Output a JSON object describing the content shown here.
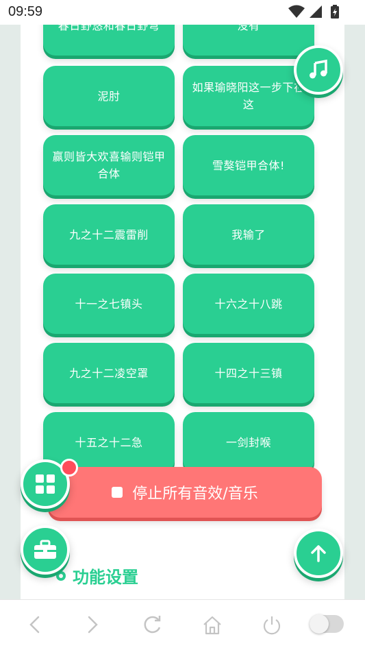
{
  "status_bar": {
    "time": "09:59"
  },
  "sound_buttons": [
    "春日野悠和春日野穹",
    "没有",
    "泥肘",
    "如果瑜晓阳这一步下在这",
    "赢则皆大欢喜输则铠甲合体",
    "雪獒铠甲合体!",
    "九之十二震雷削",
    "我输了",
    "十一之七镇头",
    "十六之十八跳",
    "九之十二凌空罩",
    "十四之十三镇",
    "十五之十二急",
    "一剑封喉"
  ],
  "stop_button": {
    "label": "停止所有音效/音乐"
  },
  "settings_section": {
    "title": "功能设置"
  },
  "fabs": {
    "music": "music-note-icon",
    "apps": "apps-grid-icon",
    "toolbox": "toolbox-icon",
    "scroll_top": "arrow-up-icon"
  },
  "nav_bar": {
    "items": [
      "back-icon",
      "forward-icon",
      "reload-icon",
      "home-icon",
      "power-icon",
      "toggle-switch"
    ]
  },
  "colors": {
    "primary": "#2acf92",
    "danger": "#ff7676",
    "badge": "#ff4d5a"
  }
}
